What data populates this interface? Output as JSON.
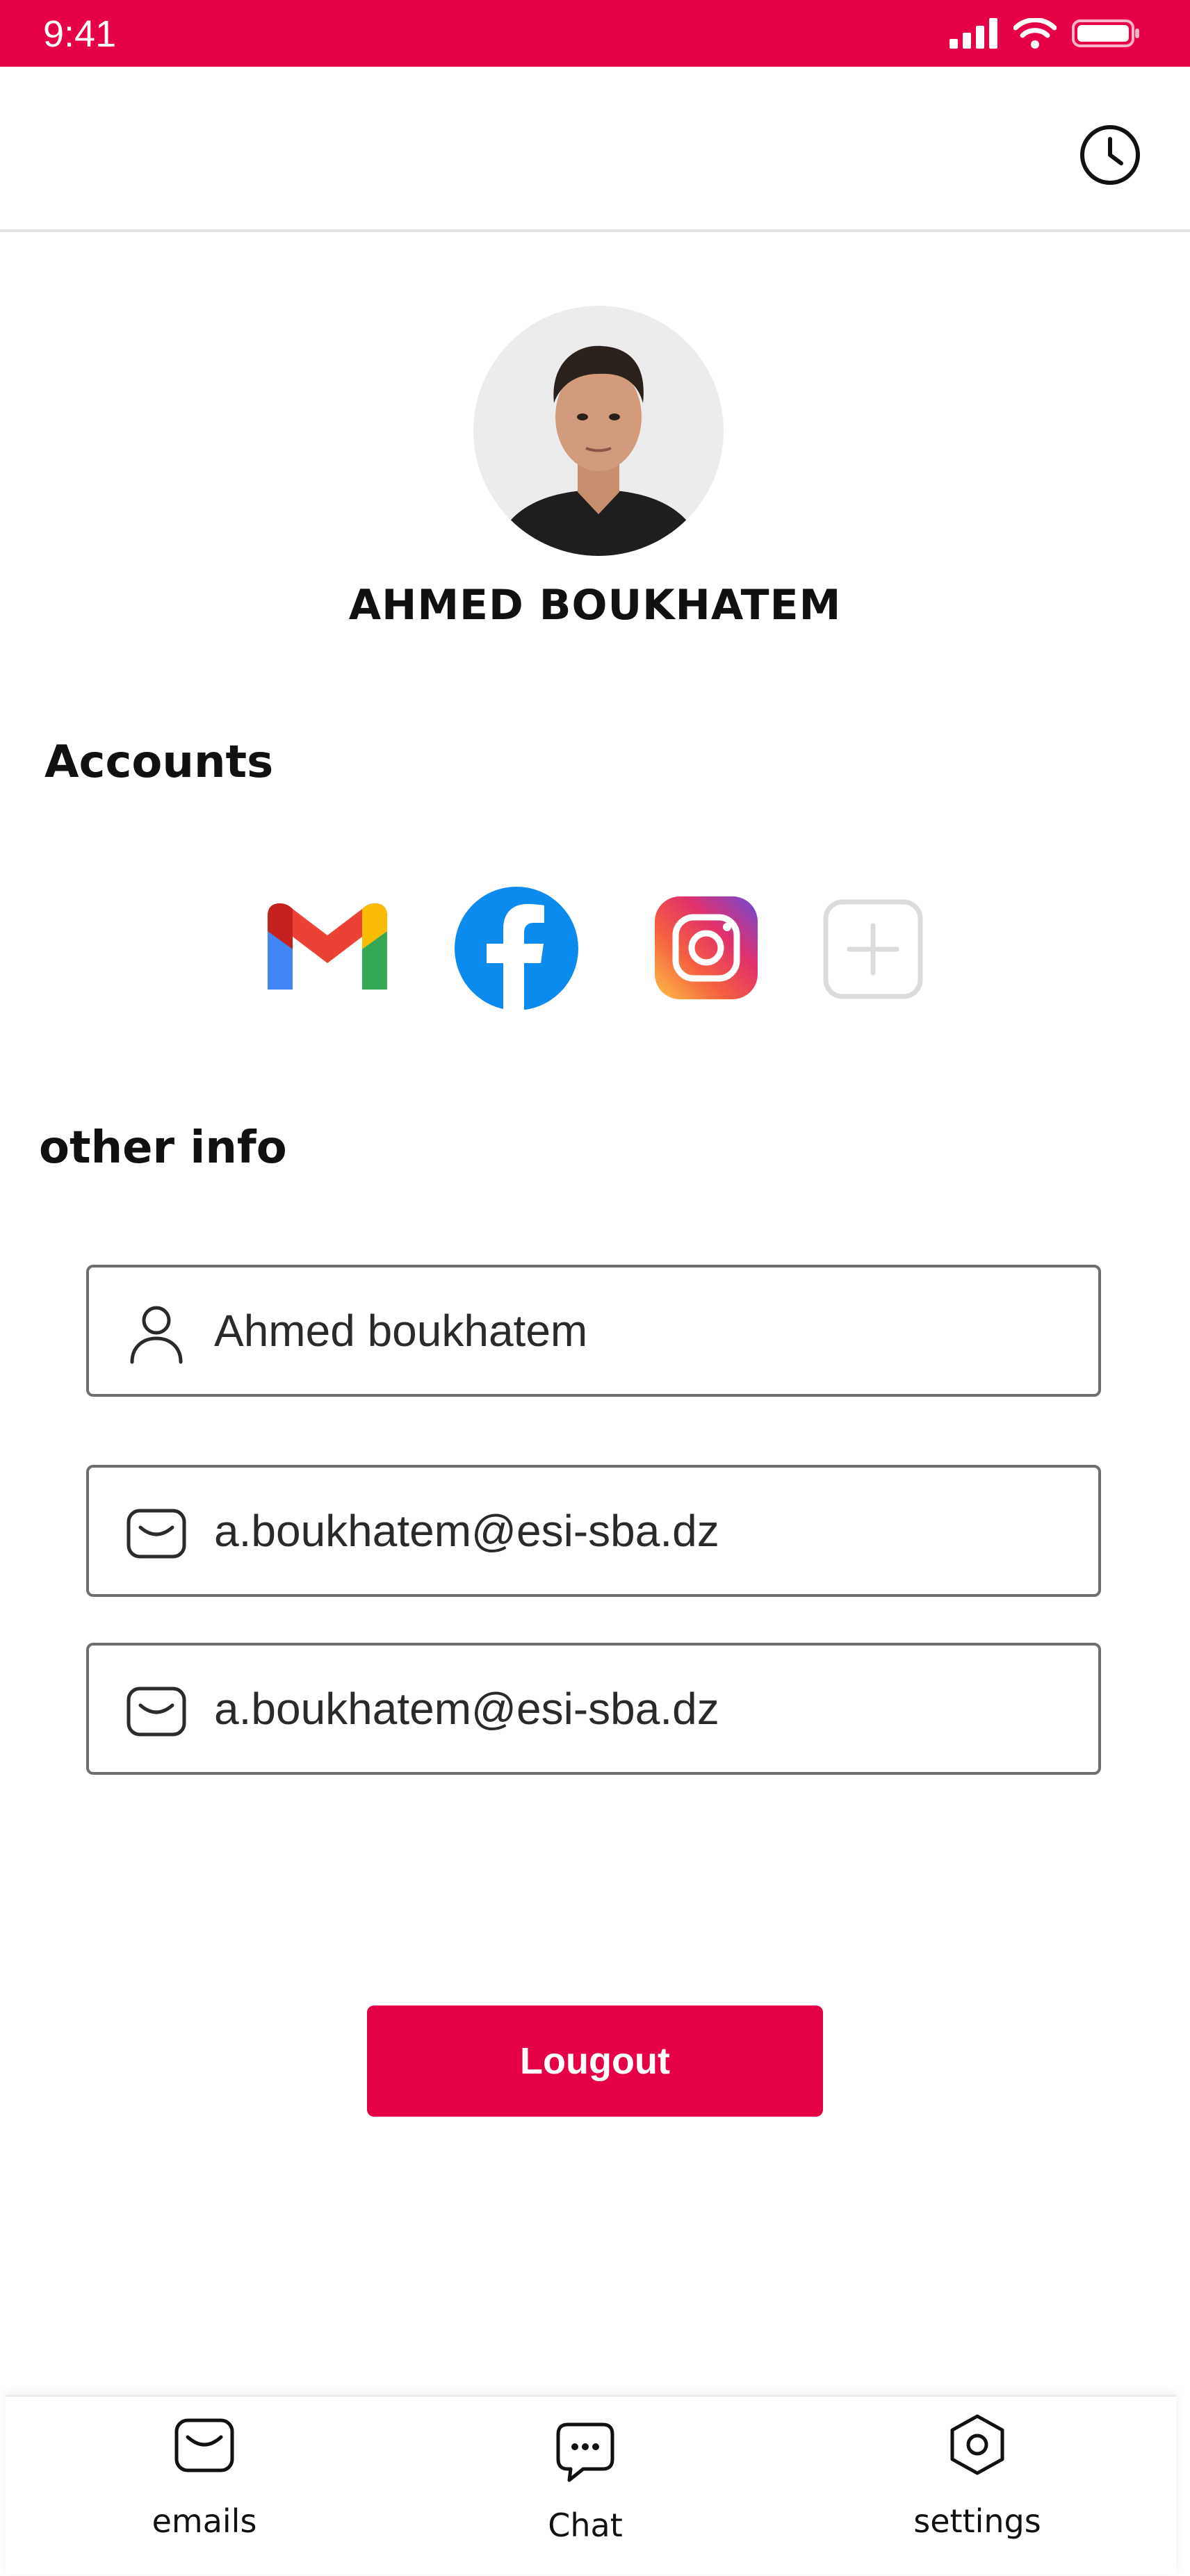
{
  "status_bar": {
    "time": "9:41"
  },
  "profile": {
    "name": "AHMED BOUKHATEM"
  },
  "sections": {
    "accounts": "Accounts",
    "other_info": "other info"
  },
  "accounts": [
    {
      "service": "gmail",
      "icon": "gmail-icon"
    },
    {
      "service": "facebook",
      "icon": "facebook-icon"
    },
    {
      "service": "instagram",
      "icon": "instagram-icon"
    },
    {
      "service": "add",
      "icon": "add-account-icon"
    }
  ],
  "fields": {
    "name": {
      "value": "Ahmed boukhatem",
      "icon": "user-icon"
    },
    "email_1": {
      "value": "a.boukhatem@esi-sba.dz",
      "icon": "mail-icon"
    },
    "email_2": {
      "value": "a.boukhatem@esi-sba.dz",
      "icon": "mail-icon"
    }
  },
  "actions": {
    "logout": "Lougout"
  },
  "bottom_nav": [
    {
      "label": "emails",
      "icon": "mail-icon"
    },
    {
      "label": "Chat",
      "icon": "chat-icon"
    },
    {
      "label": "settings",
      "icon": "settings-icon"
    }
  ],
  "colors": {
    "accent": "#e60046",
    "field_border": "#6e6e6e",
    "divider": "#e4e4e4"
  }
}
